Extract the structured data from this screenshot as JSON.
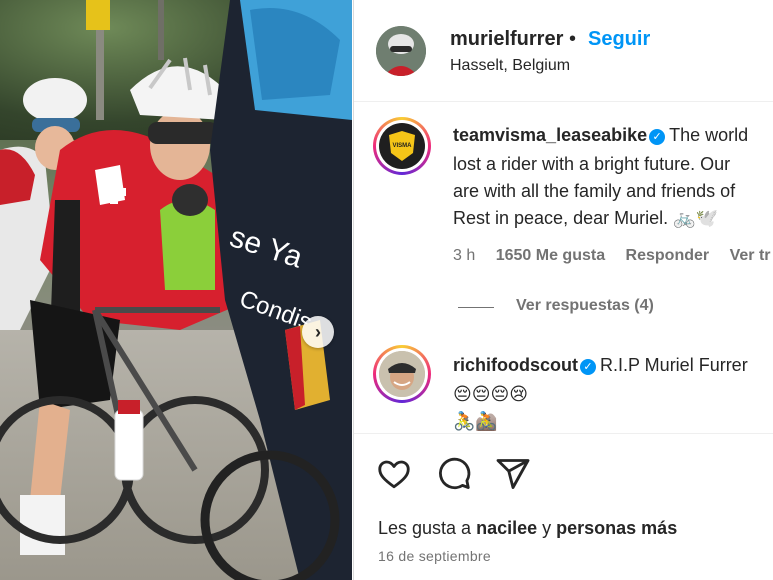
{
  "post": {
    "username": "murielfurrer",
    "separator": "•",
    "follow_label": "Seguir",
    "location": "Hasselt, Belgium"
  },
  "comments": [
    {
      "username": "teamvisma_leaseabike",
      "lines": [
        "The world",
        "lost a rider with a bright future. Our",
        "are with all the family and friends of",
        "Rest in peace, dear Muriel. 🚲🕊️"
      ],
      "time": "3 h",
      "likes": "1650 Me gusta",
      "reply_label": "Responder",
      "translate_label": "Ver tr",
      "view_replies": "Ver respuestas (4)"
    },
    {
      "username": "richifoodscout",
      "lines": [
        "R.I.P Muriel Furrer",
        "😔😔😔😢",
        "🚴🚵"
      ]
    }
  ],
  "footer": {
    "likes_prefix": "Les gusta a ",
    "likes_user": "nacilee",
    "likes_mid": " y ",
    "likes_rest": "personas más",
    "date": "16 de septiembre"
  },
  "icons": [
    "heart-icon",
    "comment-icon",
    "share-icon",
    "verified-icon",
    "chevron-right-icon"
  ],
  "colors": {
    "accent": "#0095f6",
    "text": "#262626",
    "muted": "#737373"
  }
}
